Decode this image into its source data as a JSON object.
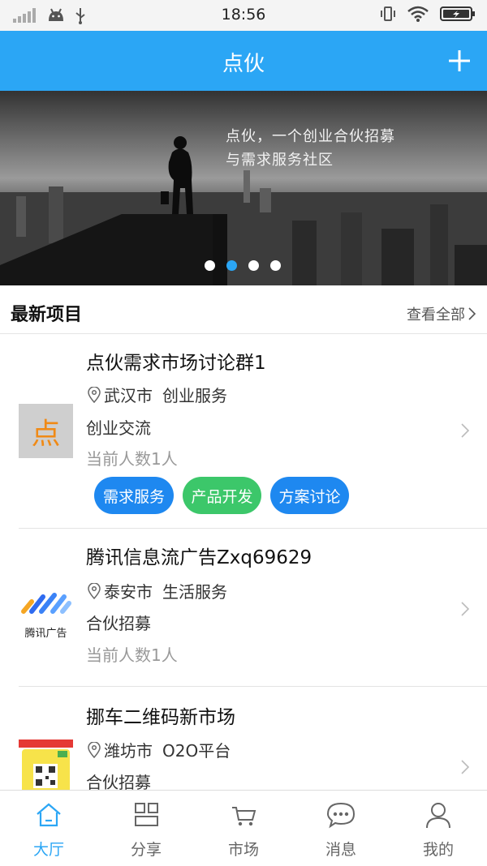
{
  "status_bar": {
    "time": "18:56"
  },
  "app_bar": {
    "title": "点伙"
  },
  "banner": {
    "line1": "点伙，一个创业合伙招募",
    "line2": "与需求服务社区",
    "slides": 4,
    "active_slide": 2
  },
  "section": {
    "title": "最新项目",
    "view_all": "查看全部"
  },
  "projects": [
    {
      "title": "点伙需求市场讨论群1",
      "city": "武汉市",
      "category": "创业服务",
      "type": "创业交流",
      "count": "当前人数1人",
      "thumb_char": "点",
      "tags": [
        "需求服务",
        "产品开发",
        "方案讨论"
      ]
    },
    {
      "title": "腾讯信息流广告Zxq69629",
      "city": "泰安市",
      "category": "生活服务",
      "type": "合伙招募",
      "count": "当前人数1人",
      "thumb_caption": "腾讯广告"
    },
    {
      "title": "挪车二维码新市场",
      "city": "潍坊市",
      "category": "O2O平台",
      "type": "合伙招募"
    }
  ],
  "tag_colors": [
    "#1e88f0",
    "#3cc76a",
    "#1e88f0"
  ],
  "tabs": [
    {
      "label": "大厅",
      "icon": "home-icon",
      "active": true
    },
    {
      "label": "分享",
      "icon": "grid-icon",
      "active": false
    },
    {
      "label": "市场",
      "icon": "cart-icon",
      "active": false
    },
    {
      "label": "消息",
      "icon": "chat-icon",
      "active": false
    },
    {
      "label": "我的",
      "icon": "user-icon",
      "active": false
    }
  ],
  "colors": {
    "accent": "#2ba6f5",
    "tag_blue": "#1e88f0",
    "tag_green": "#3cc76a"
  }
}
